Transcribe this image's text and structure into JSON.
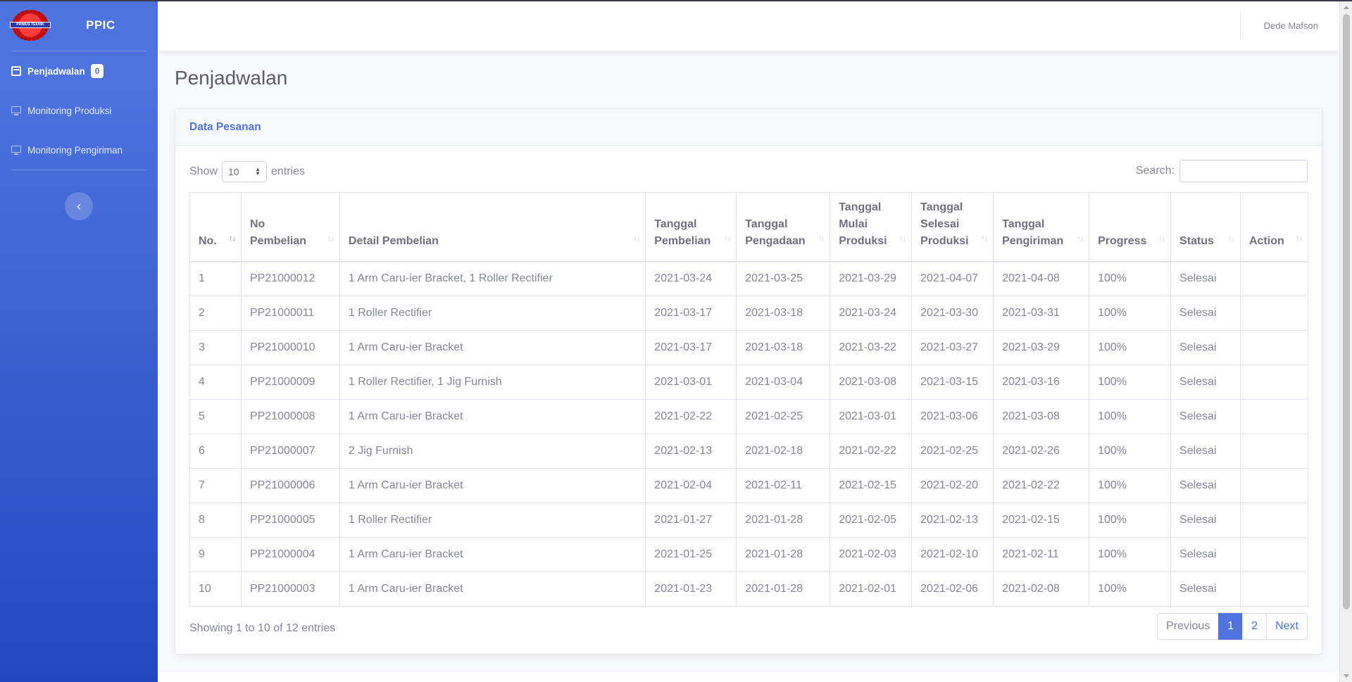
{
  "brand": {
    "name": "PPIC",
    "logo_text": "PRIMUS TEKNIK"
  },
  "sidebar": {
    "items": [
      {
        "label": "Penjadwalan",
        "badge": "0",
        "icon": "calendar-icon",
        "active": true
      },
      {
        "label": "Monitoring Produksi",
        "icon": "monitor-icon"
      },
      {
        "label": "Monitoring Pengiriman",
        "icon": "monitor-icon"
      }
    ],
    "toggle_icon": "‹"
  },
  "topbar": {
    "user": "Dede Mafson"
  },
  "page": {
    "title": "Penjadwalan"
  },
  "card": {
    "title": "Data Pesanan"
  },
  "controls": {
    "show_label": "Show",
    "entries_value": "10",
    "entries_label": "entries",
    "search_label": "Search:",
    "search_value": ""
  },
  "table": {
    "headers": [
      [
        "No."
      ],
      [
        "No",
        "Pembelian"
      ],
      [
        "Detail Pembelian"
      ],
      [
        "Tanggal",
        "Pembelian"
      ],
      [
        "Tanggal",
        "Pengadaan"
      ],
      [
        "Tanggal",
        "Mulai",
        "Produksi"
      ],
      [
        "Tanggal",
        "Selesai",
        "Produksi"
      ],
      [
        "Tanggal",
        "Pengiriman"
      ],
      [
        "Progress"
      ],
      [
        "Status"
      ],
      [
        "Action"
      ]
    ],
    "rows": [
      [
        "1",
        "PP21000012",
        "1 Arm Caru-ier Bracket, 1 Roller Rectifier",
        "2021-03-24",
        "2021-03-25",
        "2021-03-29",
        "2021-04-07",
        "2021-04-08",
        "100%",
        "Selesai",
        ""
      ],
      [
        "2",
        "PP21000011",
        "1 Roller Rectifier",
        "2021-03-17",
        "2021-03-18",
        "2021-03-24",
        "2021-03-30",
        "2021-03-31",
        "100%",
        "Selesai",
        ""
      ],
      [
        "3",
        "PP21000010",
        "1 Arm Caru-ier Bracket",
        "2021-03-17",
        "2021-03-18",
        "2021-03-22",
        "2021-03-27",
        "2021-03-29",
        "100%",
        "Selesai",
        ""
      ],
      [
        "4",
        "PP21000009",
        "1 Roller Rectifier, 1 Jig Furnish",
        "2021-03-01",
        "2021-03-04",
        "2021-03-08",
        "2021-03-15",
        "2021-03-16",
        "100%",
        "Selesai",
        ""
      ],
      [
        "5",
        "PP21000008",
        "1 Arm Caru-ier Bracket",
        "2021-02-22",
        "2021-02-25",
        "2021-03-01",
        "2021-03-06",
        "2021-03-08",
        "100%",
        "Selesai",
        ""
      ],
      [
        "6",
        "PP21000007",
        "2 Jig Furnish",
        "2021-02-13",
        "2021-02-18",
        "2021-02-22",
        "2021-02-25",
        "2021-02-26",
        "100%",
        "Selesai",
        ""
      ],
      [
        "7",
        "PP21000006",
        "1 Arm Caru-ier Bracket",
        "2021-02-04",
        "2021-02-11",
        "2021-02-15",
        "2021-02-20",
        "2021-02-22",
        "100%",
        "Selesai",
        ""
      ],
      [
        "8",
        "PP21000005",
        "1 Roller Rectifier",
        "2021-01-27",
        "2021-01-28",
        "2021-02-05",
        "2021-02-13",
        "2021-02-15",
        "100%",
        "Selesai",
        ""
      ],
      [
        "9",
        "PP21000004",
        "1 Arm Caru-ier Bracket",
        "2021-01-25",
        "2021-01-28",
        "2021-02-03",
        "2021-02-10",
        "2021-02-11",
        "100%",
        "Selesai",
        ""
      ],
      [
        "10",
        "PP21000003",
        "1 Arm Caru-ier Bracket",
        "2021-01-23",
        "2021-01-28",
        "2021-02-01",
        "2021-02-06",
        "2021-02-08",
        "100%",
        "Selesai",
        ""
      ]
    ]
  },
  "footer": {
    "info": "Showing 1 to 10 of 12 entries",
    "pagination": {
      "previous": "Previous",
      "pages": [
        "1",
        "2"
      ],
      "current": "1",
      "next": "Next"
    }
  },
  "colors": {
    "primary": "#4e73df",
    "sidebar_dark": "#224abe",
    "text": "#858796"
  }
}
